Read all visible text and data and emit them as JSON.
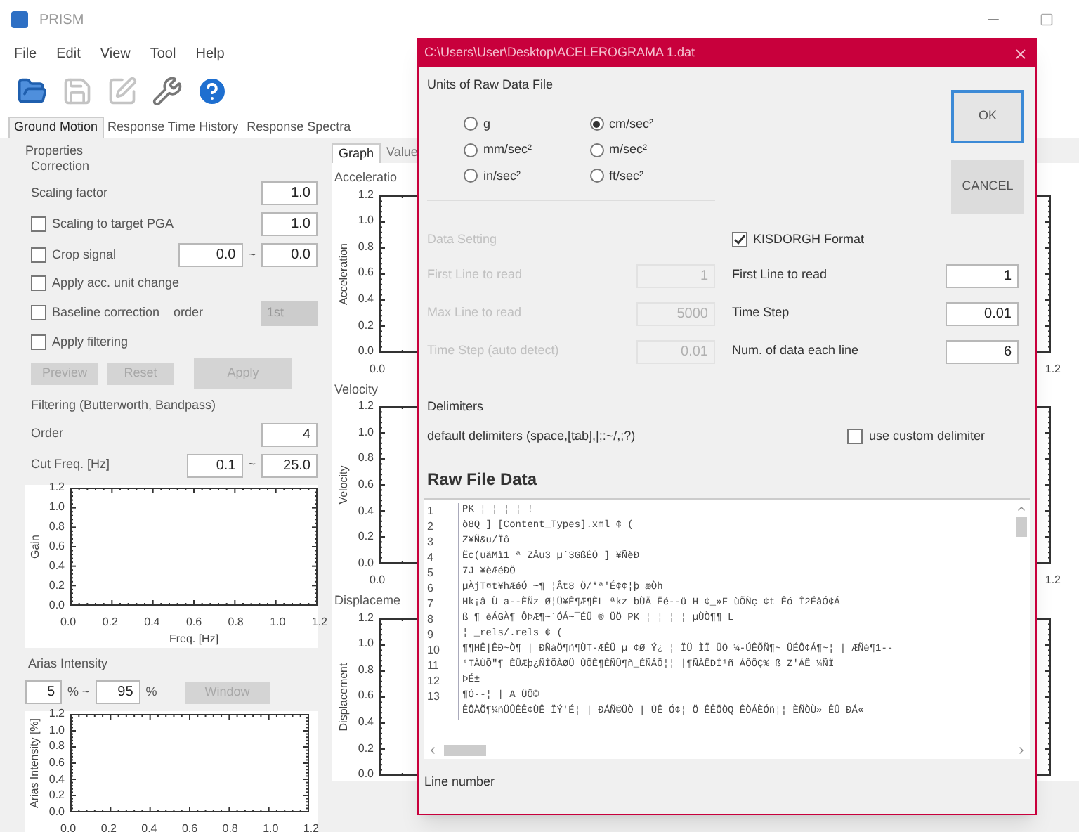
{
  "window": {
    "title": "PRISM"
  },
  "menu": [
    "File",
    "Edit",
    "View",
    "Tool",
    "Help"
  ],
  "toolbar": [
    {
      "kind": "open",
      "disabled": false
    },
    {
      "kind": "save",
      "disabled": true
    },
    {
      "kind": "edit",
      "disabled": true
    },
    {
      "kind": "tool",
      "disabled": false
    },
    {
      "kind": "help",
      "disabled": false
    }
  ],
  "tabs": [
    {
      "label": "Ground Motion",
      "selected": true
    },
    {
      "label": "Response Time History",
      "selected": false
    },
    {
      "label": "Response Spectra",
      "selected": false
    }
  ],
  "properties": {
    "title": "Properties",
    "correction": "Correction",
    "scaling": {
      "label": "Scaling factor",
      "value": "1.0"
    },
    "target_pga": {
      "label": "Scaling to target PGA",
      "checked": false,
      "value": "1.0"
    },
    "crop": {
      "label": "Crop signal",
      "checked": false,
      "from": "0.0",
      "sep": "~",
      "to": "0.0"
    },
    "unit_change": {
      "label": "Apply acc. unit change",
      "checked": false
    },
    "baseline": {
      "label": "Baseline correction",
      "checked": false,
      "order_label": "order",
      "order": "1st"
    },
    "filtering": {
      "label": "Apply filtering",
      "checked": false
    },
    "buttons": [
      {
        "label": "Preview",
        "disabled": true
      },
      {
        "label": "Reset",
        "disabled": true
      },
      {
        "label": "Apply",
        "disabled": true
      }
    ],
    "filter_title": "Filtering (Butterworth, Bandpass)",
    "order": {
      "label": "Order",
      "value": "4"
    },
    "cutfreq": {
      "label": "Cut Freq. [Hz]",
      "from": "0.1",
      "sep": "~",
      "to": "25.0"
    },
    "gain_plot": {
      "ylabel": "Gain",
      "xlabel": "Freq. [Hz]",
      "yticks": [
        "1.2",
        "1.0",
        "0.8",
        "0.6",
        "0.4",
        "0.2",
        "0.0"
      ],
      "xticks": [
        "0.0",
        "0.2",
        "0.4",
        "0.6",
        "0.8",
        "1.0",
        "1.2"
      ]
    },
    "arias_title": "Arias Intensity",
    "arias": {
      "from": "5",
      "unit1": "% ~",
      "to": "95",
      "unit2": "%",
      "button": "Window",
      "disabled": true
    },
    "arias_plot": {
      "ylabel": "Arias Intensity [%]",
      "yticks": [
        "1.2",
        "1.0",
        "0.8",
        "0.6",
        "0.4",
        "0.2",
        "0.0"
      ],
      "xticks": [
        "0.0",
        "0.2",
        "0.4",
        "0.6",
        "0.8",
        "1.0",
        "1.2"
      ]
    }
  },
  "graph_tabs": [
    {
      "label": "Graph",
      "selected": true
    },
    {
      "label": "Value",
      "selected": false
    }
  ],
  "graphs": [
    {
      "title": "Acceleratio",
      "ylabel": "Acceleration",
      "yticks": [
        "1.2",
        "1.0",
        "0.8",
        "0.6",
        "0.4",
        "0.2",
        "0.0"
      ],
      "xticks": [
        "0.0",
        "1.2"
      ]
    },
    {
      "title": "Velocity",
      "ylabel": "Velocity",
      "yticks": [
        "1.2",
        "1.0",
        "0.8",
        "0.6",
        "0.4",
        "0.2",
        "0.0"
      ],
      "xticks": [
        "0.0",
        "1.2"
      ]
    },
    {
      "title": "Displaceme",
      "ylabel": "Displacement",
      "yticks": [
        "1.2",
        "1.0",
        "0.8",
        "0.6",
        "0.4",
        "0.2",
        "0.0"
      ]
    }
  ],
  "dialog": {
    "title": "C:\\Users\\User\\Desktop\\ACELEROGRAMA 1.dat",
    "units_title": "Units of Raw Data File",
    "units": [
      {
        "label": "g",
        "selected": false
      },
      {
        "label": "cm/sec²",
        "selected": true
      },
      {
        "label": "mm/sec²",
        "selected": false
      },
      {
        "label": "m/sec²",
        "selected": false
      },
      {
        "label": "in/sec²",
        "selected": false
      },
      {
        "label": "ft/sec²",
        "selected": false
      }
    ],
    "ok": "OK",
    "cancel": "CANCEL",
    "data_setting": {
      "title": "Data Setting",
      "disabled": true,
      "rows": [
        {
          "label": "First Line to read",
          "value": "1"
        },
        {
          "label": "Max Line to read",
          "value": "5000"
        },
        {
          "label": "Time Step  (auto detect)",
          "value": "0.01"
        }
      ]
    },
    "format": {
      "label": "KISDORGH Format",
      "checked": true,
      "rows": [
        {
          "label": "First Line to read",
          "value": "1"
        },
        {
          "label": "Time Step",
          "value": "0.01"
        },
        {
          "label": "Num. of data each line",
          "value": "6"
        }
      ]
    },
    "delimiters_title": "Delimiters",
    "delimiters": "default delimiters (space,[tab],|;:~/,;?)",
    "custom": {
      "label": "use custom delimiter",
      "checked": false
    },
    "raw_title": "Raw File Data",
    "raw_lines": [
      {
        "num": "1",
        "text": "PK ¦ ¦  ¦  ¦     !"
      },
      {
        "num": "2",
        "text": "ò8Q    ]    [Content_Types].xml ¢   ("
      },
      {
        "num": "3",
        "text": "Z¥Ñ&u/Ïô"
      },
      {
        "num": "4",
        "text": "Ëc(uäMì1 ª ZÅu3 µ´3GßÉÖ ] ¥ÑèÐ"
      },
      {
        "num": "5",
        "text": "7J  ¥èÆéÐÖ"
      },
      {
        "num": "6",
        "text": "µÀjT¤t¥hÆéÓ ~¶  ¦Ât8 Ö/*ª'É¢¢¦þ   æÒh"
      },
      {
        "num": "7",
        "text": "Hk¡â Ù a--ÈÑz Ø¦Ü¥Ê¶Æ¶ÈL  ªkz bÙÄ    Ëé--ü H  ¢_»F  ùÕÑç ¢t Êó  Î2ÉåÓ¢Á"
      },
      {
        "num": "8",
        "text": "ß  ¶ éÁGÀ¶ ÔÞÆ¶~´ÓÁ~¯ÉÜ  ®    ÜÖ  PK    ¦  ¦  ¦     ¦  µÙÒ¶¶     L"
      },
      {
        "num": "9",
        "text": " ¦   _rels/.rels ¢   ("
      },
      {
        "num": "10",
        "text": "¶¶HÊ|ÊÐ~Ò¶ |  ÐÑàÖ¶ñ¶ÙT-ÆÊÜ µ  ¢Ø  Ý¿  ¦ ÏÜ ÌÏ  ÜÖ ¼-ÚÊÕÑ¶~  ÜÉÔ¢Á¶~¦ |  ÆÑè¶1--"
      },
      {
        "num": "11",
        "text": "°TÀÙÕ\"¶ ÈÜÆþ¿ÑÌÕÀØÜ ÙÔÈ¶ÈÑÛ¶ñ_ÉÑÁÖ¦¦ |¶ÑÀÊÐÍ¹ñ ÁÔÔÇ% ß Z'ÁÊ  ¼ÑÏ"
      },
      {
        "num": "12",
        "text": "ÞÉ±"
      },
      {
        "num": "13",
        "text": "¶Ó--¦ |  A  ÜÔ©"
      },
      {
        "text": "ÊÔÀÕ¶¼ñÜÛÊÊ¢ÙÊ ÏÝ'É¦  |  ÐÁÑ©ÜÒ  |  ÜÊ  Ó¢¦ Ö ÊÊÖÒQ ÊÒÁÈÓñ¦¦  ÈÑÒÙ» ÊÛ  ÐÁ«"
      }
    ],
    "line_number": "Line number"
  }
}
